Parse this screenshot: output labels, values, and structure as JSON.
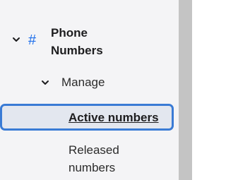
{
  "nav": {
    "section": {
      "title": "Phone Numbers",
      "icon": "hash-icon",
      "icon_glyph": "#",
      "expanded": true
    },
    "group": {
      "label": "Manage",
      "expanded": true
    },
    "items": [
      {
        "label": "Active numbers",
        "active": true
      },
      {
        "label": "Released numbers",
        "active": false
      }
    ]
  },
  "colors": {
    "accent": "#3a7bd5",
    "icon": "#1f6feb",
    "panel_bg": "#f4f4f6",
    "active_bg": "#e3e7ef",
    "scrollbar": "#c4c4c4"
  }
}
